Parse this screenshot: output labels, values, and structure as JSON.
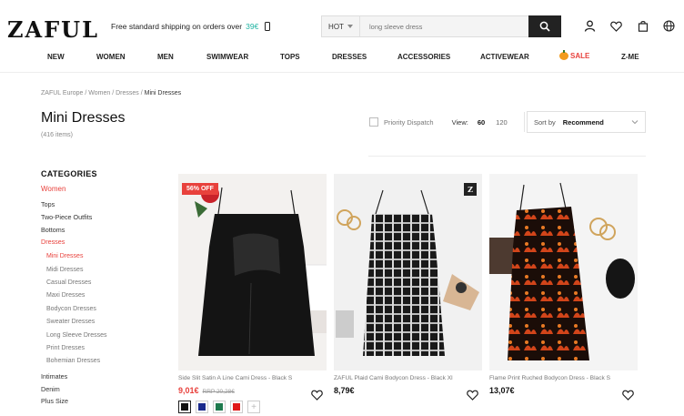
{
  "header": {
    "logo": "ZAFUL",
    "shipping_text": "Free standard shipping on orders over",
    "shipping_amount": "39€",
    "search_category": "HOT",
    "search_placeholder": "long sleeve dress"
  },
  "nav": [
    "NEW",
    "WOMEN",
    "MEN",
    "SWIMWEAR",
    "TOPS",
    "DRESSES",
    "ACCESSORIES",
    "ACTIVEWEAR",
    "SALE",
    "Z-ME"
  ],
  "breadcrumb": {
    "items": [
      "ZAFUL Europe",
      "Women",
      "Dresses"
    ],
    "current": "Mini Dresses",
    "separator": " / "
  },
  "page": {
    "title": "Mini Dresses",
    "count": "(416 items)"
  },
  "toolbar": {
    "priority_label": "Priority Dispatch",
    "view_label": "View:",
    "view_options": [
      "60",
      "120"
    ],
    "sort_label": "Sort by",
    "sort_value": "Recommend"
  },
  "sidebar": {
    "heading": "CATEGORIES",
    "women": "Women",
    "level1": [
      "Tops",
      "Two-Piece Outfits",
      "Bottoms",
      "Dresses"
    ],
    "level2": [
      "Mini Dresses",
      "Midi Dresses",
      "Casual Dresses",
      "Maxi Dresses",
      "Bodycon Dresses",
      "Sweater Dresses",
      "Long Sleeve Dresses",
      "Print Dresses",
      "Bohemian Dresses"
    ],
    "level1_after": [
      "Intimates",
      "Denim",
      "Plus Size"
    ]
  },
  "products": [
    {
      "name": "Side Slit Satin A Line Cami Dress - Black S",
      "price": "9,01€",
      "rrp": "RRP 20,28€",
      "badge": "56% OFF",
      "swatches": [
        "#111111",
        "#1a2a8c",
        "#1e7a4e",
        "#e01818"
      ]
    },
    {
      "name": "ZAFUL Plaid Cami Bodycon Dress - Black Xl",
      "price": "8,79€",
      "brand_badge": "Z"
    },
    {
      "name": "Flame Print Ruched Bodycon Dress - Black S",
      "price": "13,07€"
    }
  ],
  "colors": {
    "accent_red": "#e8413c",
    "teal": "#1fb3a2"
  }
}
